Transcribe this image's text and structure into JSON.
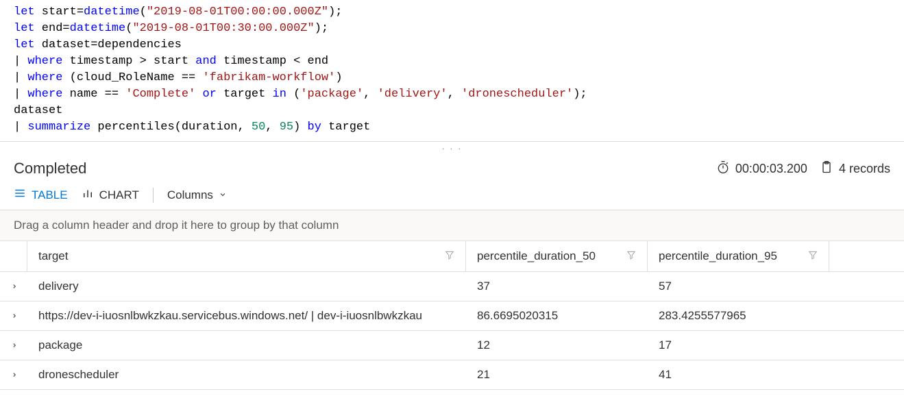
{
  "editor": {
    "start_literal": "\"2019-08-01T00:00:00.000Z\"",
    "end_literal": "\"2019-08-01T00:30:00.000Z\"",
    "role_literal": "'fabrikam-workflow'",
    "complete_literal": "'Complete'",
    "package_literal": "'package'",
    "delivery_literal": "'delivery'",
    "dronescheduler_literal": "'dronescheduler'",
    "pct50": "50",
    "pct95": "95"
  },
  "status": {
    "label": "Completed",
    "duration": "00:00:03.200",
    "records": "4 records"
  },
  "toolbar": {
    "table_label": "TABLE",
    "chart_label": "CHART",
    "columns_label": "Columns"
  },
  "hint": "Drag a column header and drop it here to group by that column",
  "columns": {
    "target": "target",
    "p50": "percentile_duration_50",
    "p95": "percentile_duration_95"
  },
  "rows": [
    {
      "target": "delivery",
      "p50": "37",
      "p95": "57"
    },
    {
      "target": "https://dev-i-iuosnlbwkzkau.servicebus.windows.net/ | dev-i-iuosnlbwkzkau",
      "p50": "86.6695020315",
      "p95": "283.4255577965"
    },
    {
      "target": "package",
      "p50": "12",
      "p95": "17"
    },
    {
      "target": "dronescheduler",
      "p50": "21",
      "p95": "41"
    }
  ]
}
